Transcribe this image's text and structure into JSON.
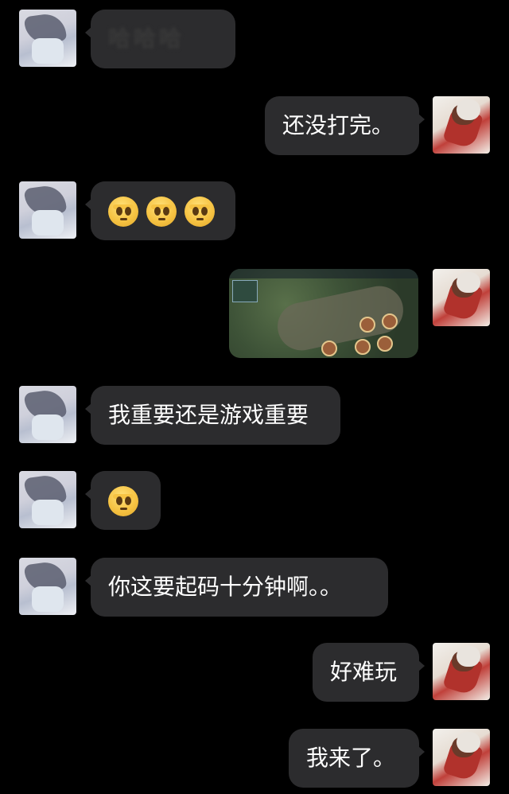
{
  "messages": [
    {
      "side": "left",
      "type": "text",
      "text": "哈哈哈",
      "blurred": true
    },
    {
      "side": "right",
      "type": "text",
      "text": "还没打完。"
    },
    {
      "side": "left",
      "type": "emoji",
      "emoji": "flushed-face-emoji",
      "count": 3
    },
    {
      "side": "right",
      "type": "image",
      "image": "game-screenshot"
    },
    {
      "side": "left",
      "type": "text",
      "text": "我重要还是游戏重要"
    },
    {
      "side": "left",
      "type": "emoji",
      "emoji": "flushed-face-emoji",
      "count": 1
    },
    {
      "side": "left",
      "type": "text",
      "text": "你这要起码十分钟啊。。"
    },
    {
      "side": "right",
      "type": "text",
      "text": "好难玩"
    },
    {
      "side": "right",
      "type": "text",
      "text": "我来了。"
    }
  ],
  "colors": {
    "background": "#000000",
    "bubble": "#2c2c2e",
    "text": "#ffffff"
  }
}
